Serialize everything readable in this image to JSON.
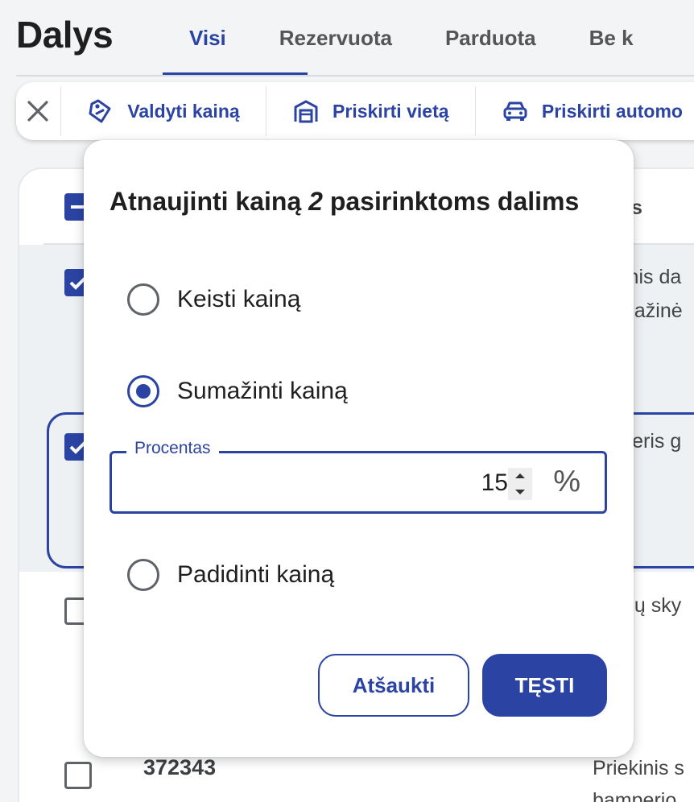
{
  "app": {
    "title": "Dalys"
  },
  "tabs": [
    {
      "label": "Visi",
      "active": true
    },
    {
      "label": "Rezervuota",
      "active": false
    },
    {
      "label": "Parduota",
      "active": false
    },
    {
      "label": "Be k",
      "active": false
    }
  ],
  "toolbar": {
    "close_icon": "close-icon",
    "items": [
      {
        "label": "Valdyti kainą",
        "icon": "price-tag-icon"
      },
      {
        "label": "Priskirti vietą",
        "icon": "garage-icon"
      },
      {
        "label": "Priskirti automo",
        "icon": "car-icon"
      }
    ]
  },
  "background_list": {
    "header_fragment": "s",
    "rows": [
      {
        "checked": true,
        "text_lines": [
          "inis da",
          "gažinė"
        ]
      },
      {
        "checked": true,
        "text_lines": [
          "ileris g"
        ]
      },
      {
        "checked": false,
        "text_lines": [
          "gų sky"
        ]
      },
      {
        "checked": false,
        "code": "372343",
        "text_lines": [
          "Priekinis s",
          "bamperio"
        ]
      }
    ]
  },
  "dialog": {
    "title_prefix": "Atnaujinti kainą",
    "title_count": "2",
    "title_suffix": "pasirinktoms dalims",
    "options": [
      {
        "label": "Keisti kainą",
        "checked": false
      },
      {
        "label": "Sumažinti kainą",
        "checked": true
      },
      {
        "label": "Padidinti kainą",
        "checked": false
      }
    ],
    "percent_field": {
      "label": "Procentas",
      "value": "15",
      "unit": "%"
    },
    "cancel_label": "Atšaukti",
    "confirm_label": "TĘSTI"
  },
  "colors": {
    "accent": "#2b44a3",
    "background": "#f2f4f6",
    "surface": "#ffffff"
  }
}
